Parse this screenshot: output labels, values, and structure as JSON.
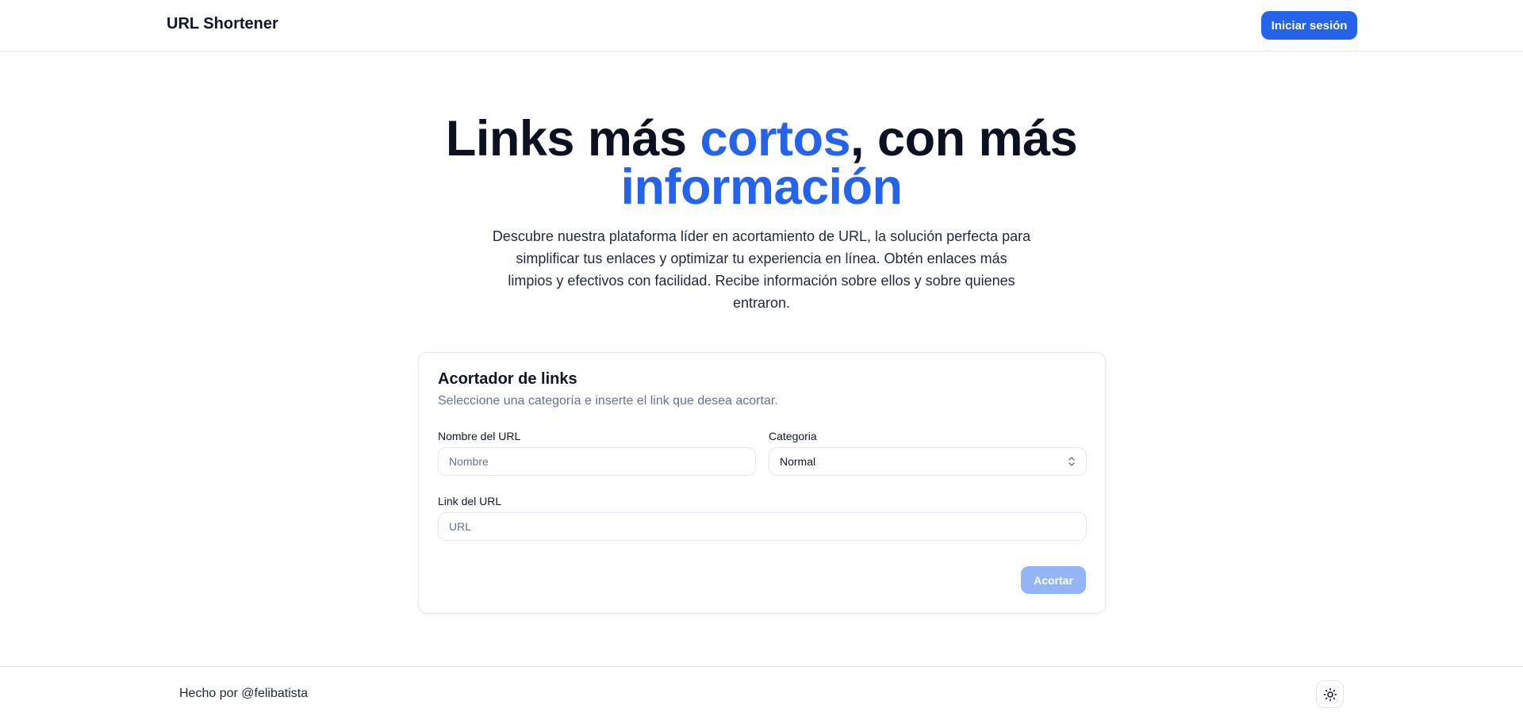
{
  "header": {
    "brand": "URL Shortener",
    "login_label": "Iniciar sesión"
  },
  "hero": {
    "title_part1": "Links más ",
    "title_accent1": "cortos",
    "title_part2": ", con más ",
    "title_accent2": "información",
    "description": "Descubre nuestra plataforma líder en acortamiento de URL, la solución perfecta para simplificar tus enlaces y optimizar tu experiencia en línea. Obtén enlaces más limpios y efectivos con facilidad. Recibe información sobre ellos y sobre quienes entraron."
  },
  "form": {
    "title": "Acortador de links",
    "subtitle": "Seleccione una categoría e inserte el link que desea acortar.",
    "name_label": "Nombre del URL",
    "name_value": "",
    "name_placeholder": "Nombre",
    "category_label": "Categoria",
    "category_selected": "Normal",
    "link_label": "Link del URL",
    "link_value": "",
    "link_placeholder": "URL",
    "submit_label": "Acortar"
  },
  "footer": {
    "credit": "Hecho por @felibatista",
    "theme_toggle_icon": "sun-icon"
  },
  "colors": {
    "accent": "#2563eb",
    "accent_disabled": "#93b4f5",
    "text_dark": "#0f172a",
    "text_muted": "#64748b",
    "border": "#e2e8f0"
  }
}
